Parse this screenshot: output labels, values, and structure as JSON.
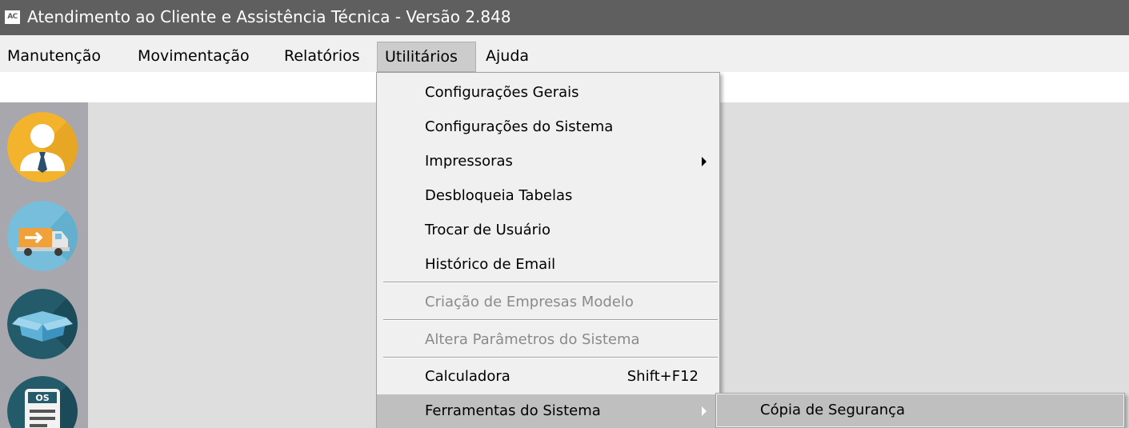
{
  "window": {
    "icon_text": "AC",
    "title": "Atendimento ao Cliente e Assistência Técnica - Versão 2.848"
  },
  "menubar": {
    "items": [
      {
        "label": "Manutenção"
      },
      {
        "label": "Movimentação"
      },
      {
        "label": "Relatórios"
      },
      {
        "label": "Utilitários",
        "active": true
      },
      {
        "label": "Ajuda"
      }
    ]
  },
  "sidebar": {
    "buttons": [
      {
        "icon": "customer-person-icon",
        "color": "#f3b32d"
      },
      {
        "icon": "delivery-truck-icon",
        "color": "#77bedc"
      },
      {
        "icon": "box-icon",
        "color": "#245b6b"
      },
      {
        "icon": "service-order-os-icon",
        "color": "#245b6b",
        "text": "OS"
      }
    ]
  },
  "utilitarios_menu": {
    "items": [
      {
        "label": "Configurações Gerais"
      },
      {
        "label": "Configurações do Sistema"
      },
      {
        "label": "Impressoras",
        "has_submenu": true
      },
      {
        "label": "Desbloqueia Tabelas"
      },
      {
        "label": "Trocar de Usuário"
      },
      {
        "label": "Histórico de Email"
      },
      {
        "label": "Criação de Empresas Modelo",
        "disabled": true
      },
      {
        "label": "Altera Parâmetros do Sistema",
        "disabled": true
      },
      {
        "label": "Calculadora",
        "shortcut": "Shift+F12"
      },
      {
        "label": "Ferramentas do Sistema",
        "has_submenu": true,
        "highlighted": true
      }
    ]
  },
  "ferramentas_submenu": {
    "items": [
      {
        "label": "Cópia de Segurança",
        "highlighted": true
      }
    ]
  },
  "colors": {
    "titlebar": "#5f5f5f",
    "menu_highlight": "#bfbfbf",
    "workspace": "#dedede",
    "sidebar": "#a8a7ad"
  }
}
